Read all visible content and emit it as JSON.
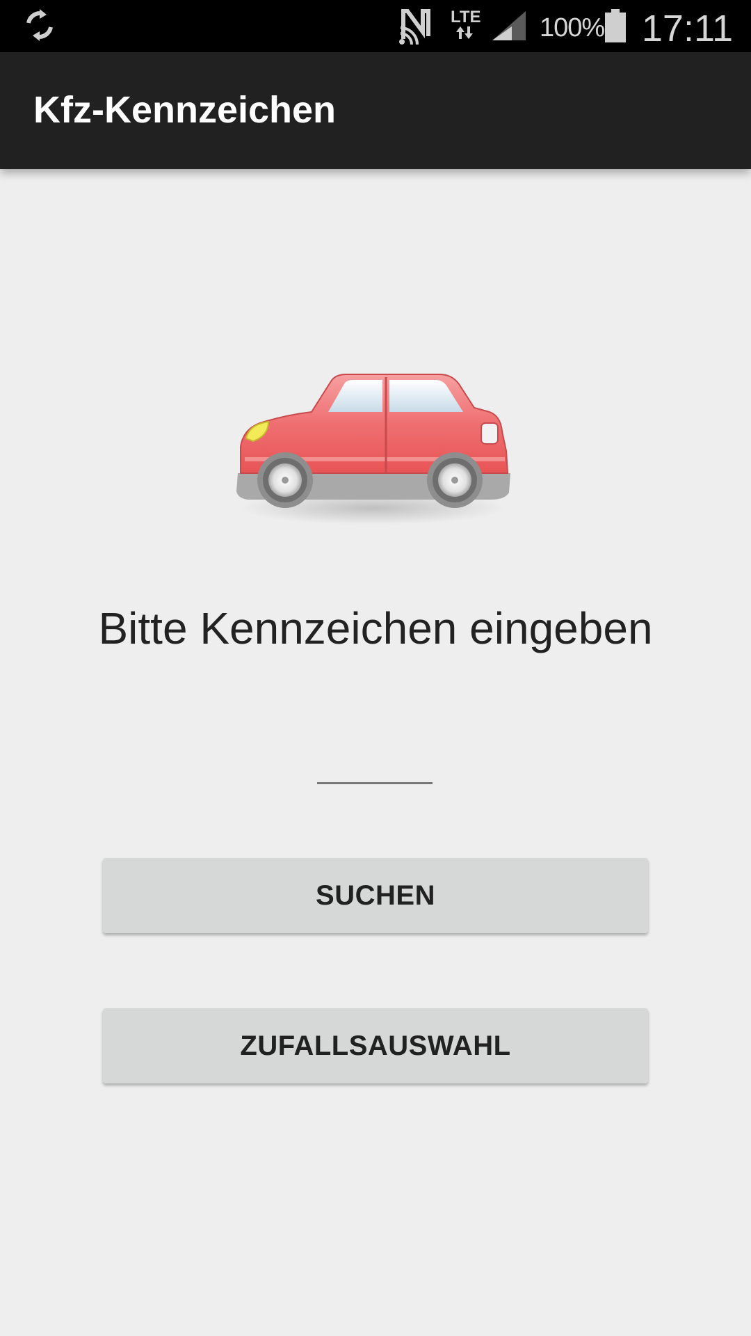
{
  "status_bar": {
    "battery_percent": "100%",
    "time": "17:11",
    "network": "LTE",
    "icons": [
      "sync-icon",
      "nfc-icon",
      "lte-icon",
      "signal-icon",
      "battery-icon"
    ]
  },
  "app_bar": {
    "title": "Kfz-Kennzeichen"
  },
  "main": {
    "illustration": "car-icon",
    "prompt": "Bitte Kennzeichen eingeben",
    "plate_input": {
      "value": "",
      "placeholder": ""
    },
    "search_button": "SUCHEN",
    "random_button": "ZUFALLSAUSWAHL"
  },
  "colors": {
    "status_bar": "#000000",
    "app_bar": "#212121",
    "background": "#eeeeee",
    "button": "#d6d7d7",
    "car_body": "#ef6a6c"
  }
}
